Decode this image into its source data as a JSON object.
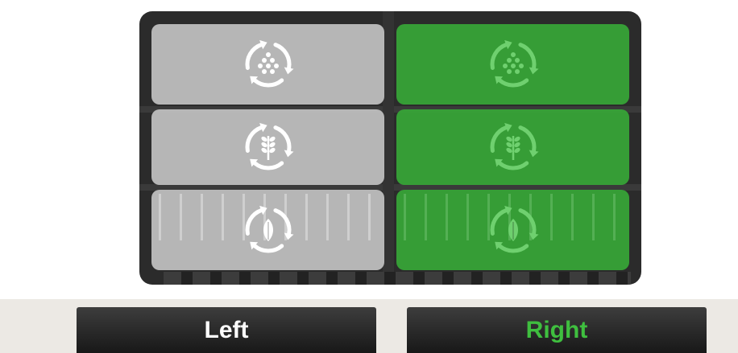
{
  "buttons": {
    "left_label": "Left",
    "right_label": "Right"
  },
  "tiles": {
    "left": [
      {
        "icon": "grain-recycle-icon"
      },
      {
        "icon": "wheat-recycle-icon"
      },
      {
        "icon": "crop-recycle-icon"
      }
    ],
    "right": [
      {
        "icon": "grain-recycle-icon"
      },
      {
        "icon": "wheat-recycle-icon"
      },
      {
        "icon": "crop-recycle-icon"
      }
    ]
  },
  "colors": {
    "left_tile": "#c2c2c2",
    "right_tile": "#37aa37",
    "right_accent": "#3fbf3f",
    "left_icon": "#ffffff",
    "panel": "#2b2b2b"
  }
}
